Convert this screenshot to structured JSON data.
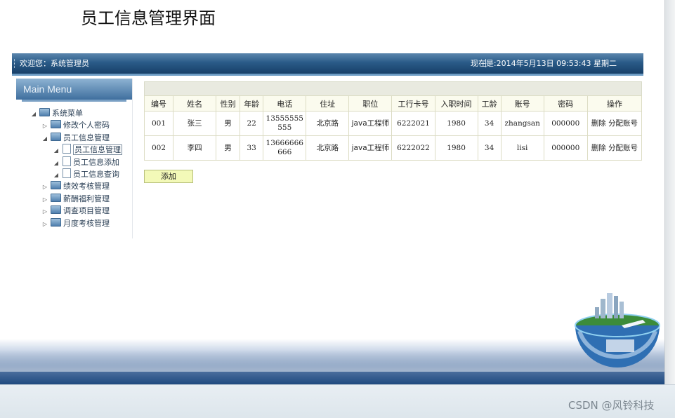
{
  "page": {
    "title": "员工信息管理界面"
  },
  "topbar": {
    "welcome": "欢迎您：系统管理员",
    "datetime": "现在是:2014年5月13日  09:53:43 星期二"
  },
  "sidebar": {
    "header": "Main Menu",
    "tree": [
      {
        "label": "系统菜单",
        "level": 0,
        "type": "folder",
        "expanded": true
      },
      {
        "label": "修改个人密码",
        "level": 1,
        "type": "folder",
        "expanded": false
      },
      {
        "label": "员工信息管理",
        "level": 1,
        "type": "folder",
        "expanded": true
      },
      {
        "label": "员工信息管理",
        "level": 2,
        "type": "doc",
        "selected": true
      },
      {
        "label": "员工信息添加",
        "level": 2,
        "type": "doc"
      },
      {
        "label": "员工信息查询",
        "level": 2,
        "type": "doc"
      },
      {
        "label": "绩效考核管理",
        "level": 1,
        "type": "folder",
        "expanded": false
      },
      {
        "label": "薪酬福利管理",
        "level": 1,
        "type": "folder",
        "expanded": false
      },
      {
        "label": "调查项目管理",
        "level": 1,
        "type": "folder",
        "expanded": false
      },
      {
        "label": "月度考核管理",
        "level": 1,
        "type": "folder",
        "expanded": false
      }
    ]
  },
  "table": {
    "columns": [
      "编号",
      "姓名",
      "性别",
      "年龄",
      "电话",
      "住址",
      "职位",
      "工行卡号",
      "入职时间",
      "工龄",
      "账号",
      "密码",
      "操作"
    ],
    "rows": [
      {
        "id": "001",
        "name": "张三",
        "gender": "男",
        "age": "22",
        "phone": "13555555555",
        "address": "北京路",
        "position": "java工程师",
        "card": "6222021",
        "joined": "1980",
        "years": "34",
        "account": "zhangsan",
        "password": "000000",
        "action_delete": "删除",
        "action_assign": "分配账号"
      },
      {
        "id": "002",
        "name": "李四",
        "gender": "男",
        "age": "33",
        "phone": "13666666666",
        "address": "北京路",
        "position": "java工程师",
        "card": "6222022",
        "joined": "1980",
        "years": "34",
        "account": "lisi",
        "password": "000000",
        "action_delete": "删除",
        "action_assign": "分配账号"
      }
    ]
  },
  "actions": {
    "add_label": "添加"
  },
  "watermark": "CSDN @风铃科技",
  "colors": {
    "topbar": "#1f4a76",
    "grid_header": "#fbfbee",
    "add_button": "#f3f9b8"
  }
}
